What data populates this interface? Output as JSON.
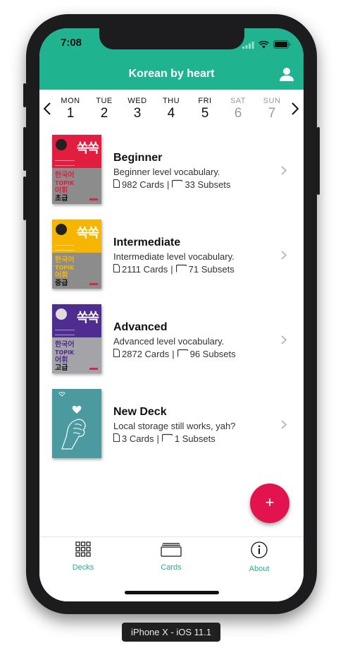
{
  "status_bar": {
    "time": "7:08"
  },
  "header": {
    "title": "Korean by heart"
  },
  "week": {
    "days": [
      {
        "name": "MON",
        "date": "1"
      },
      {
        "name": "TUE",
        "date": "2"
      },
      {
        "name": "WED",
        "date": "3"
      },
      {
        "name": "THU",
        "date": "4"
      },
      {
        "name": "FRI",
        "date": "5"
      },
      {
        "name": "SAT",
        "date": "6"
      },
      {
        "name": "SUN",
        "date": "7"
      }
    ]
  },
  "decks": [
    {
      "name": "Beginner",
      "description": "Beginner level vocabulary.",
      "cards": "982 Cards",
      "separator": "|",
      "subsets": "33 Subsets",
      "cover": {
        "title": "쏙쏙",
        "subtitle_1": "한국어",
        "subtitle_2": "TOPIK",
        "subtitle_3": "어휘",
        "subtitle_4": "초급",
        "color": "#e31d3f"
      }
    },
    {
      "name": "Intermediate",
      "description": "Intermediate level vocabulary.",
      "cards": "2111 Cards",
      "separator": "|",
      "subsets": "71 Subsets",
      "cover": {
        "title": "쏙쏙",
        "subtitle_1": "한국어",
        "subtitle_2": "TOPIK",
        "subtitle_3": "어휘",
        "subtitle_4": "중급",
        "color": "#f6b600"
      }
    },
    {
      "name": "Advanced",
      "description": "Advanced level vocabulary.",
      "cards": "2872 Cards",
      "separator": "|",
      "subsets": "96 Subsets",
      "cover": {
        "title": "쏙쏙",
        "subtitle_1": "한국어",
        "subtitle_2": "TOPIK",
        "subtitle_3": "어휘",
        "subtitle_4": "고급",
        "color": "#4f2c8f"
      }
    },
    {
      "name": "New Deck",
      "description": "Local storage still works, yah?",
      "cards": "3 Cards",
      "separator": "|",
      "subsets": "1 Subsets",
      "cover": {
        "color": "#4a9aa0"
      }
    }
  ],
  "fab": {
    "label": "+"
  },
  "tabbar": {
    "tabs": [
      {
        "label": "Decks",
        "icon": "grid-icon"
      },
      {
        "label": "Cards",
        "icon": "cards-icon"
      },
      {
        "label": "About",
        "icon": "info-icon"
      }
    ]
  },
  "simulator_label": "iPhone X - iOS 11.1",
  "colors": {
    "accent": "#1fb38f",
    "fab": "#e3134f",
    "weekend": "#9a9a9a"
  }
}
